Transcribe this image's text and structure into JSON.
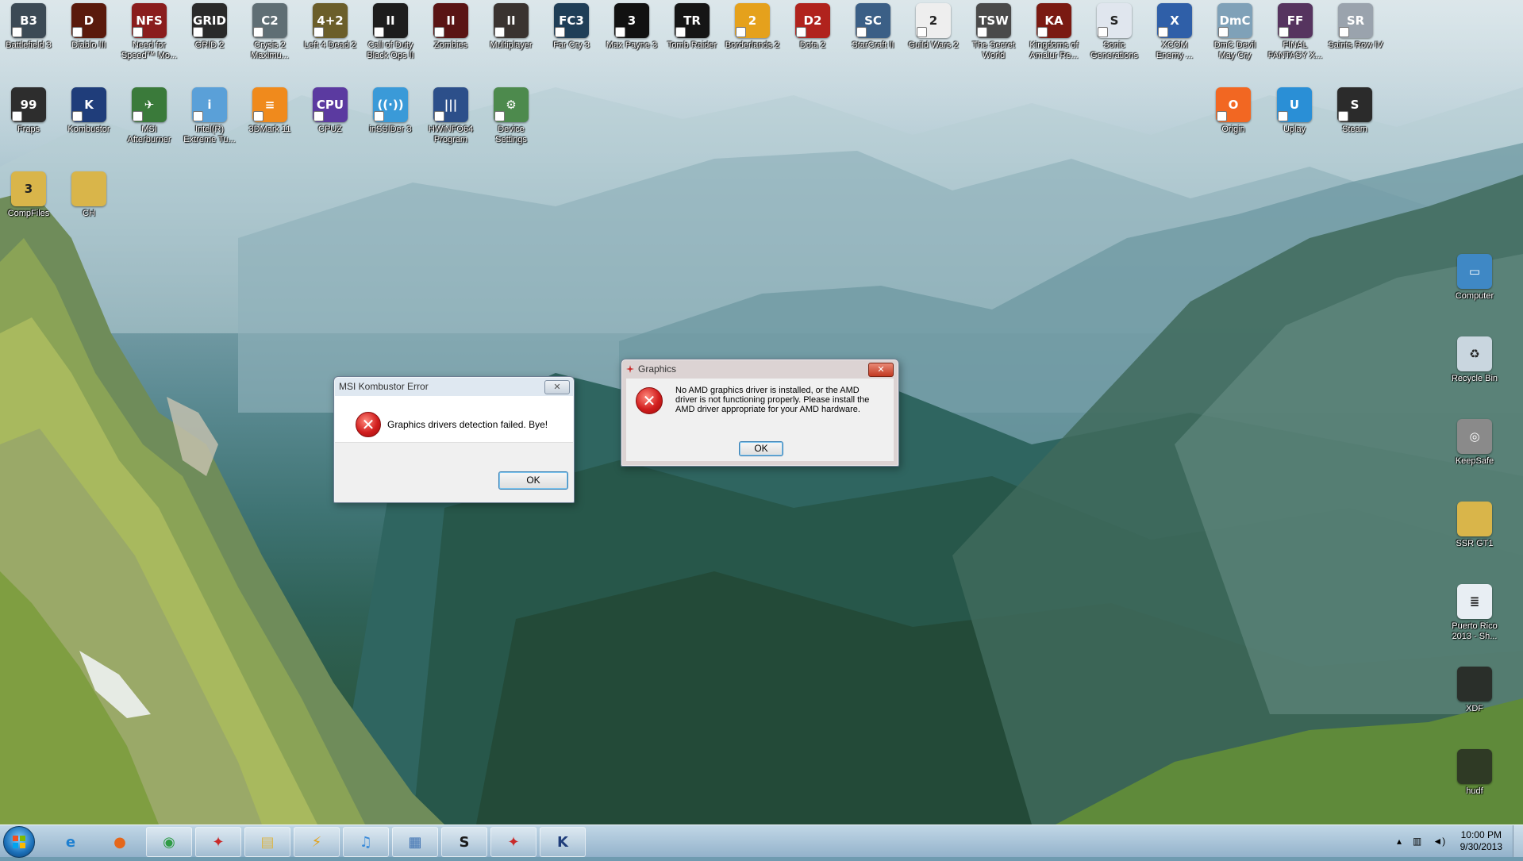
{
  "desktop": {
    "icons_top": [
      {
        "label": "Battlefield 3",
        "icon": "soldier-icon",
        "color": "#3c4a55",
        "glyph": "B3"
      },
      {
        "label": "Diablo III",
        "icon": "diablo-icon",
        "color": "#5a1a0c",
        "glyph": "D"
      },
      {
        "label": "Need for\nSpeed™ Mo...",
        "icon": "nfs-icon",
        "color": "#8a1d1d",
        "glyph": "NFS"
      },
      {
        "label": "GRID 2",
        "icon": "grid-icon",
        "color": "#2a2a2a",
        "glyph": "GRID"
      },
      {
        "label": "Crysis 2\nMaximu...",
        "icon": "crysis-icon",
        "color": "#5f6e74",
        "glyph": "C2"
      },
      {
        "label": "Left 4 Dead 2",
        "icon": "l4d2-icon",
        "color": "#6b5e2a",
        "glyph": "4+2"
      },
      {
        "label": "Call of Duty\nBlack Ops II",
        "icon": "cod-icon",
        "color": "#1d1d1d",
        "glyph": "II"
      },
      {
        "label": "Zombies",
        "icon": "zombies-icon",
        "color": "#5a1414",
        "glyph": "II"
      },
      {
        "label": "Multiplayer",
        "icon": "multiplayer-icon",
        "color": "#3a3330",
        "glyph": "II"
      },
      {
        "label": "Far Cry 3",
        "icon": "farcry-icon",
        "color": "#1f3e57",
        "glyph": "FC3"
      },
      {
        "label": "Max Payne 3",
        "icon": "maxpayne-icon",
        "color": "#111111",
        "glyph": "3"
      },
      {
        "label": "Tomb Raider",
        "icon": "tombraider-icon",
        "color": "#151515",
        "glyph": "TR"
      },
      {
        "label": "Borderlands 2",
        "icon": "borderlands-icon",
        "color": "#e5a11c",
        "glyph": "2"
      },
      {
        "label": "Dota 2",
        "icon": "dota-icon",
        "color": "#b0231d",
        "glyph": "D2"
      },
      {
        "label": "StarCraft II",
        "icon": "starcraft-icon",
        "color": "#3b5f86",
        "glyph": "SC"
      },
      {
        "label": "Guild Wars 2",
        "icon": "guildwars-icon",
        "color": "#eeeeee",
        "glyph": "2"
      },
      {
        "label": "The Secret\nWorld",
        "icon": "secretworld-icon",
        "color": "#4a4a4a",
        "glyph": "TSW"
      },
      {
        "label": "Kingdoms of\nAmalur Re...",
        "icon": "amalur-icon",
        "color": "#7a1a12",
        "glyph": "KA"
      },
      {
        "label": "Sonic\nGenerations",
        "icon": "sonic-icon",
        "color": "#e0e6ee",
        "glyph": "S"
      },
      {
        "label": "XCOM\nEnemy ...",
        "icon": "xcom-icon",
        "color": "#2f5fa8",
        "glyph": "X"
      },
      {
        "label": "DmC Devil\nMay Cry",
        "icon": "dmc-icon",
        "color": "#7fa1b8",
        "glyph": "DmC"
      },
      {
        "label": "FINAL\nFANTASY X...",
        "icon": "finalfantasy-icon",
        "color": "#56345f",
        "glyph": "FF"
      },
      {
        "label": "Saints Row IV",
        "icon": "saintsrow-icon",
        "color": "#9aa3ad",
        "glyph": "SR"
      }
    ],
    "icons_row2": [
      {
        "label": "Fraps",
        "icon": "fraps-icon",
        "color": "#2d2d2d",
        "glyph": "99"
      },
      {
        "label": "Kombustor",
        "icon": "kombustor-icon",
        "color": "#1f3d7a",
        "glyph": "K"
      },
      {
        "label": "MSI\nAfterburner",
        "icon": "afterburner-icon",
        "color": "#3a7a3a",
        "glyph": "✈"
      },
      {
        "label": "Intel(R)\nExtreme Tu...",
        "icon": "intel-icon",
        "color": "#5aa0d8",
        "glyph": "i"
      },
      {
        "label": "3DMark 11",
        "icon": "3dmark-icon",
        "color": "#f08a1c",
        "glyph": "≡"
      },
      {
        "label": "CPUZ",
        "icon": "cpuz-icon",
        "color": "#5b3aa0",
        "glyph": "CPU"
      },
      {
        "label": "inSSIDer 3",
        "icon": "inssider-icon",
        "color": "#3a9ad8",
        "glyph": "((·))"
      },
      {
        "label": "HWiNFO64\nProgram",
        "icon": "hwinfo-icon",
        "color": "#2c4f8a",
        "glyph": "|||"
      },
      {
        "label": "Device\nSettings",
        "icon": "device-settings-icon",
        "color": "#4d8a4d",
        "glyph": "⚙"
      }
    ],
    "icons_row2_right": [
      {
        "label": "Origin",
        "icon": "origin-icon",
        "color": "#f26722",
        "glyph": "O"
      },
      {
        "label": "Uplay",
        "icon": "uplay-icon",
        "color": "#2a8fd6",
        "glyph": "U"
      },
      {
        "label": "Steam",
        "icon": "steam-icon",
        "color": "#2b2b2b",
        "glyph": "S"
      }
    ],
    "icons_row3": [
      {
        "label": "CompFiles",
        "icon": "folder-icon",
        "color": "#d9b54a",
        "glyph": "3"
      },
      {
        "label": "CH",
        "icon": "folder-icon",
        "color": "#d9b54a",
        "glyph": ""
      }
    ],
    "icons_right": [
      {
        "label": "Computer",
        "icon": "computer-icon",
        "color": "#3f88c5",
        "glyph": "▭"
      },
      {
        "label": "Recycle Bin",
        "icon": "recycle-bin-icon",
        "color": "#c9d6df",
        "glyph": "♻"
      },
      {
        "label": "KeepSafe",
        "icon": "keepsafe-icon",
        "color": "#8a8a8a",
        "glyph": "◎"
      },
      {
        "label": "SSR GT1",
        "icon": "folder-icon",
        "color": "#d9b54a",
        "glyph": ""
      },
      {
        "label": "Puerto Rico\n2013 - Sh...",
        "icon": "document-icon",
        "color": "#e8eef3",
        "glyph": "≣"
      },
      {
        "label": "XDF",
        "icon": "file-icon",
        "color": "#2a2f2a",
        "glyph": ""
      },
      {
        "label": "hudf",
        "icon": "file-icon",
        "color": "#2f3a25",
        "glyph": ""
      }
    ]
  },
  "kombustor_dialog": {
    "title": "MSI Kombustor Error",
    "close": "✕",
    "message": "Graphics drivers detection failed. Bye!",
    "ok": "OK"
  },
  "graphics_dialog": {
    "title": "Graphics",
    "close": "✕",
    "message": "No AMD graphics driver is installed, or the AMD driver is not functioning properly. Please install the AMD driver appropriate for your AMD hardware.",
    "ok": "OK"
  },
  "taskbar": {
    "pinned": [
      {
        "name": "internet-explorer",
        "glyph": "e",
        "color": "#1d7fd1"
      },
      {
        "name": "firefox",
        "glyph": "●",
        "color": "#e5671b"
      },
      {
        "name": "chrome",
        "glyph": "◉",
        "color": "#2f9c45"
      },
      {
        "name": "graphics-app",
        "glyph": "✦",
        "color": "#c92a2a"
      },
      {
        "name": "explorer",
        "glyph": "▤",
        "color": "#d9b54a"
      },
      {
        "name": "winamp",
        "glyph": "⚡",
        "color": "#e3a21a"
      },
      {
        "name": "itunes",
        "glyph": "♫",
        "color": "#3a8ad9"
      },
      {
        "name": "control-panel",
        "glyph": "▦",
        "color": "#3b6fb0"
      },
      {
        "name": "steam",
        "glyph": "S",
        "color": "#1b1b1b"
      },
      {
        "name": "graphics-app-2",
        "glyph": "✦",
        "color": "#c92a2a"
      },
      {
        "name": "kombustor",
        "glyph": "K",
        "color": "#1f3d7a"
      }
    ],
    "time": "10:00 PM",
    "date": "9/30/2013"
  }
}
